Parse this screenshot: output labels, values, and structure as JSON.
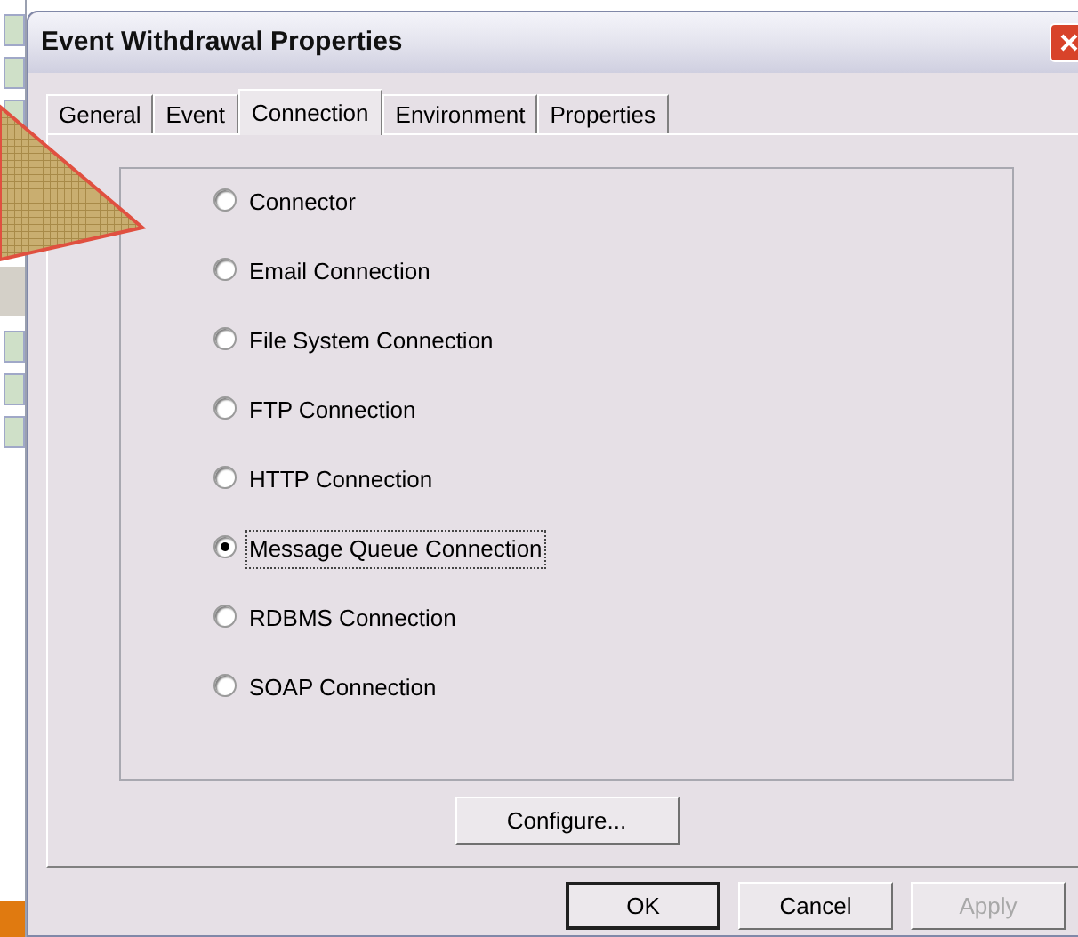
{
  "window": {
    "title": "Event Withdrawal Properties"
  },
  "tabs": [
    {
      "label": "General",
      "selected": false
    },
    {
      "label": "Event",
      "selected": false
    },
    {
      "label": "Connection",
      "selected": true
    },
    {
      "label": "Environment",
      "selected": false
    },
    {
      "label": "Properties",
      "selected": false
    }
  ],
  "connection_types": [
    {
      "label": "Connector",
      "selected": false
    },
    {
      "label": "Email Connection",
      "selected": false
    },
    {
      "label": "File System Connection",
      "selected": false
    },
    {
      "label": "FTP Connection",
      "selected": false
    },
    {
      "label": "HTTP Connection",
      "selected": false
    },
    {
      "label": "Message Queue Connection",
      "selected": true
    },
    {
      "label": "RDBMS Connection",
      "selected": false
    },
    {
      "label": "SOAP Connection",
      "selected": false
    }
  ],
  "configure_button": {
    "label": "Configure..."
  },
  "dialog_buttons": [
    {
      "label": "OK",
      "kind": "default",
      "disabled": false
    },
    {
      "label": "Cancel",
      "kind": "normal",
      "disabled": false
    },
    {
      "label": "Apply",
      "kind": "normal",
      "disabled": true
    }
  ]
}
